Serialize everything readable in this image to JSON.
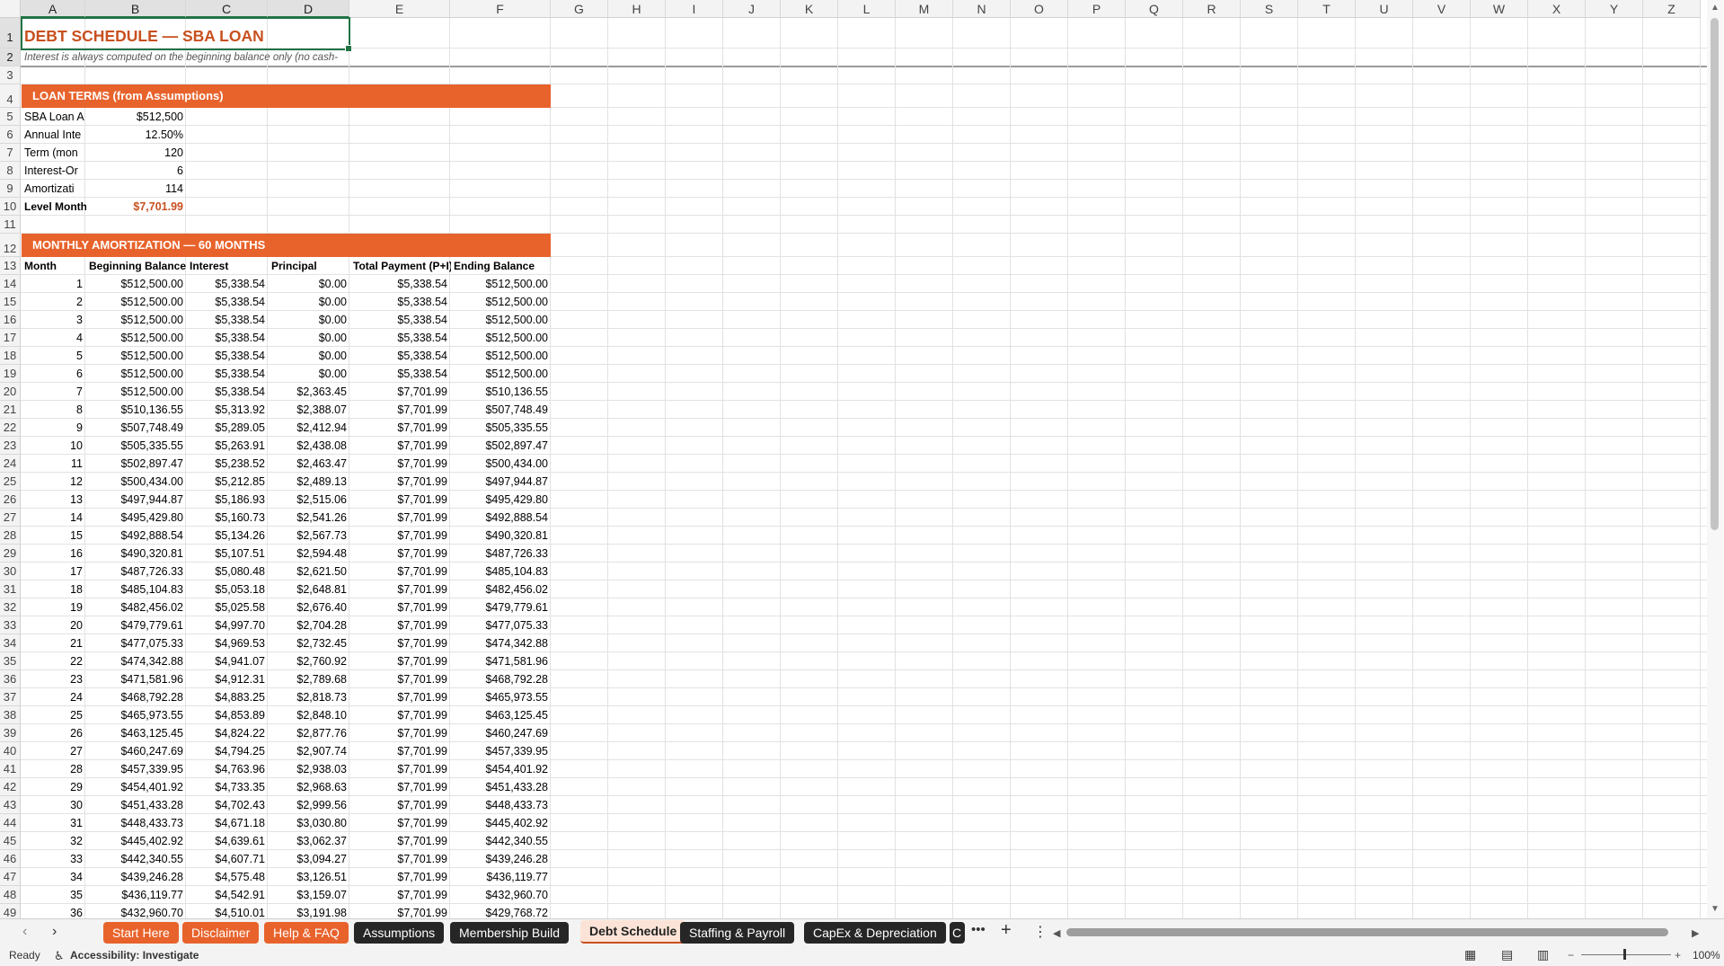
{
  "columns": [
    "A",
    "B",
    "C",
    "D",
    "E",
    "F",
    "G",
    "H",
    "I",
    "J",
    "K",
    "L",
    "M",
    "N",
    "O",
    "P",
    "Q",
    "R",
    "S",
    "T",
    "U",
    "V",
    "W",
    "X",
    "Y",
    "Z"
  ],
  "sheet": {
    "title": "DEBT SCHEDULE — SBA LOAN",
    "subtitle": "Interest is always computed on the beginning balance only (no cash-",
    "loan_terms_band": "LOAN TERMS (from Assumptions)",
    "loan_terms": [
      {
        "label": "SBA Loan A",
        "value": "$512,500"
      },
      {
        "label": "Annual Inte",
        "value": "12.50%"
      },
      {
        "label": "Term (mon",
        "value": "120"
      },
      {
        "label": "Interest-Or",
        "value": "6"
      },
      {
        "label": "Amortizati",
        "value": "114"
      },
      {
        "label": "Level Month",
        "value": "$7,701.99"
      }
    ],
    "amort_band": "MONTHLY AMORTIZATION — 60 MONTHS",
    "headers": [
      "Month",
      "Beginning Balance",
      "Interest",
      "Principal",
      "Total Payment (P+I)",
      "Ending Balance"
    ],
    "rows": [
      [
        "1",
        "$512,500.00",
        "$5,338.54",
        "$0.00",
        "$5,338.54",
        "$512,500.00"
      ],
      [
        "2",
        "$512,500.00",
        "$5,338.54",
        "$0.00",
        "$5,338.54",
        "$512,500.00"
      ],
      [
        "3",
        "$512,500.00",
        "$5,338.54",
        "$0.00",
        "$5,338.54",
        "$512,500.00"
      ],
      [
        "4",
        "$512,500.00",
        "$5,338.54",
        "$0.00",
        "$5,338.54",
        "$512,500.00"
      ],
      [
        "5",
        "$512,500.00",
        "$5,338.54",
        "$0.00",
        "$5,338.54",
        "$512,500.00"
      ],
      [
        "6",
        "$512,500.00",
        "$5,338.54",
        "$0.00",
        "$5,338.54",
        "$512,500.00"
      ],
      [
        "7",
        "$512,500.00",
        "$5,338.54",
        "$2,363.45",
        "$7,701.99",
        "$510,136.55"
      ],
      [
        "8",
        "$510,136.55",
        "$5,313.92",
        "$2,388.07",
        "$7,701.99",
        "$507,748.49"
      ],
      [
        "9",
        "$507,748.49",
        "$5,289.05",
        "$2,412.94",
        "$7,701.99",
        "$505,335.55"
      ],
      [
        "10",
        "$505,335.55",
        "$5,263.91",
        "$2,438.08",
        "$7,701.99",
        "$502,897.47"
      ],
      [
        "11",
        "$502,897.47",
        "$5,238.52",
        "$2,463.47",
        "$7,701.99",
        "$500,434.00"
      ],
      [
        "12",
        "$500,434.00",
        "$5,212.85",
        "$2,489.13",
        "$7,701.99",
        "$497,944.87"
      ],
      [
        "13",
        "$497,944.87",
        "$5,186.93",
        "$2,515.06",
        "$7,701.99",
        "$495,429.80"
      ],
      [
        "14",
        "$495,429.80",
        "$5,160.73",
        "$2,541.26",
        "$7,701.99",
        "$492,888.54"
      ],
      [
        "15",
        "$492,888.54",
        "$5,134.26",
        "$2,567.73",
        "$7,701.99",
        "$490,320.81"
      ],
      [
        "16",
        "$490,320.81",
        "$5,107.51",
        "$2,594.48",
        "$7,701.99",
        "$487,726.33"
      ],
      [
        "17",
        "$487,726.33",
        "$5,080.48",
        "$2,621.50",
        "$7,701.99",
        "$485,104.83"
      ],
      [
        "18",
        "$485,104.83",
        "$5,053.18",
        "$2,648.81",
        "$7,701.99",
        "$482,456.02"
      ],
      [
        "19",
        "$482,456.02",
        "$5,025.58",
        "$2,676.40",
        "$7,701.99",
        "$479,779.61"
      ],
      [
        "20",
        "$479,779.61",
        "$4,997.70",
        "$2,704.28",
        "$7,701.99",
        "$477,075.33"
      ],
      [
        "21",
        "$477,075.33",
        "$4,969.53",
        "$2,732.45",
        "$7,701.99",
        "$474,342.88"
      ],
      [
        "22",
        "$474,342.88",
        "$4,941.07",
        "$2,760.92",
        "$7,701.99",
        "$471,581.96"
      ],
      [
        "23",
        "$471,581.96",
        "$4,912.31",
        "$2,789.68",
        "$7,701.99",
        "$468,792.28"
      ],
      [
        "24",
        "$468,792.28",
        "$4,883.25",
        "$2,818.73",
        "$7,701.99",
        "$465,973.55"
      ],
      [
        "25",
        "$465,973.55",
        "$4,853.89",
        "$2,848.10",
        "$7,701.99",
        "$463,125.45"
      ],
      [
        "26",
        "$463,125.45",
        "$4,824.22",
        "$2,877.76",
        "$7,701.99",
        "$460,247.69"
      ],
      [
        "27",
        "$460,247.69",
        "$4,794.25",
        "$2,907.74",
        "$7,701.99",
        "$457,339.95"
      ],
      [
        "28",
        "$457,339.95",
        "$4,763.96",
        "$2,938.03",
        "$7,701.99",
        "$454,401.92"
      ],
      [
        "29",
        "$454,401.92",
        "$4,733.35",
        "$2,968.63",
        "$7,701.99",
        "$451,433.28"
      ],
      [
        "30",
        "$451,433.28",
        "$4,702.43",
        "$2,999.56",
        "$7,701.99",
        "$448,433.73"
      ],
      [
        "31",
        "$448,433.73",
        "$4,671.18",
        "$3,030.80",
        "$7,701.99",
        "$445,402.92"
      ],
      [
        "32",
        "$445,402.92",
        "$4,639.61",
        "$3,062.37",
        "$7,701.99",
        "$442,340.55"
      ],
      [
        "33",
        "$442,340.55",
        "$4,607.71",
        "$3,094.27",
        "$7,701.99",
        "$439,246.28"
      ],
      [
        "34",
        "$439,246.28",
        "$4,575.48",
        "$3,126.51",
        "$7,701.99",
        "$436,119.77"
      ],
      [
        "35",
        "$436,119.77",
        "$4,542.91",
        "$3,159.07",
        "$7,701.99",
        "$432,960.70"
      ],
      [
        "36",
        "$432,960.70",
        "$4,510.01",
        "$3,191.98",
        "$7,701.99",
        "$429,768.72"
      ]
    ]
  },
  "tabs": [
    {
      "label": "Start Here",
      "style": "orange"
    },
    {
      "label": "Disclaimer",
      "style": "orange"
    },
    {
      "label": "Help & FAQ",
      "style": "orange"
    },
    {
      "label": "Assumptions",
      "style": "dark"
    },
    {
      "label": "Membership Build",
      "style": "dark"
    },
    {
      "label": "Debt Schedule",
      "style": "active"
    },
    {
      "label": "Staffing & Payroll",
      "style": "dark"
    },
    {
      "label": "CapEx & Depreciation",
      "style": "dark"
    },
    {
      "label": "C",
      "style": "dark"
    }
  ],
  "status": {
    "ready": "Ready",
    "accessibility": "Accessibility: Investigate",
    "zoom": "100%"
  },
  "colors": {
    "accent_orange": "#e8632c",
    "title_orange": "#c8501f",
    "excel_green": "#217346",
    "dark_tab": "#262626"
  }
}
